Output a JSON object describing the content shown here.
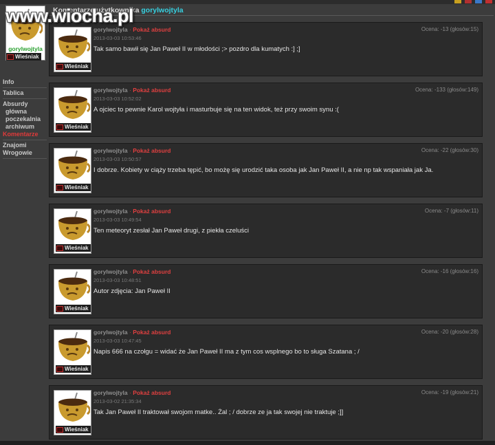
{
  "watermark": "www.wiocha.pl",
  "page": {
    "title_prefix": "Komentarze użytkownika",
    "title_user": "gorylwojtyla"
  },
  "profile": {
    "username": "gorylwojtyla",
    "rank": "Wieśniak"
  },
  "nav": [
    {
      "label": "Info",
      "level": 0,
      "active": false
    },
    {
      "label": "Tablica",
      "level": 0,
      "active": false
    },
    {
      "label": "Absurdy",
      "level": 0,
      "active": false
    },
    {
      "label": "główna",
      "level": 1,
      "active": false
    },
    {
      "label": "poczekalnia",
      "level": 1,
      "active": false
    },
    {
      "label": "archiwum",
      "level": 1,
      "active": false
    },
    {
      "label": "Komentarze",
      "level": 0,
      "active": true
    },
    {
      "label": "Znajomi",
      "level": 0,
      "active": false
    },
    {
      "label": "Wrogowie",
      "level": 0,
      "active": false
    }
  ],
  "comments": [
    {
      "author": "gorylwojtyla",
      "sep": "·",
      "link": "Pokaż absurd",
      "date": "2013-03-03 10:53:46",
      "rating": "Ocena: -13 (głosów:15)",
      "text": "Tak samo bawił się Jan Paweł II w młodości ;> pozdro dla kumatych :] ;]",
      "rank": "Wieśniak"
    },
    {
      "author": "gorylwojtyla",
      "sep": "·",
      "link": "Pokaż absurd",
      "date": "2013-03-03 10:52:02",
      "rating": "Ocena: -133 (głosów:149)",
      "text": "A ojciec to pewnie Karol wojtyła i masturbuje się na ten widok, też przy swoim synu :(",
      "rank": "Wieśniak"
    },
    {
      "author": "gorylwojtyla",
      "sep": "·",
      "link": "Pokaż absurd",
      "date": "2013-03-03 10:50:57",
      "rating": "Ocena: -22 (głosów:30)",
      "text": "I dobrze. Kobiety w ciąży trzeba tępić, bo możę się urodzić taka osoba jak Jan Paweł II, a nie np tak wspaniała jak Ja.",
      "rank": "Wieśniak"
    },
    {
      "author": "gorylwojtyla",
      "sep": "·",
      "link": "Pokaż absurd",
      "date": "2013-03-03 10:49:54",
      "rating": "Ocena: -7 (głosów:11)",
      "text": "Ten meteoryt zesłał Jan Paweł drugi, z piekła czeluści",
      "rank": "Wieśniak"
    },
    {
      "author": "gorylwojtyla",
      "sep": "·",
      "link": "Pokaż absurd",
      "date": "2013-03-03 10:48:51",
      "rating": "Ocena: -16 (głosów:16)",
      "text": "Autor zdjęcia: Jan Paweł II",
      "rank": "Wieśniak"
    },
    {
      "author": "gorylwojtyla",
      "sep": "·",
      "link": "Pokaż absurd",
      "date": "2013-03-03 10:47:45",
      "rating": "Ocena: -20 (głosów:28)",
      "text": "Napis 666 na czołgu = widać że Jan Paweł II ma z tym cos wsplnego bo to sługa Szatana ; /",
      "rank": "Wieśniak"
    },
    {
      "author": "gorylwojtyla",
      "sep": "·",
      "link": "Pokaż absurd",
      "date": "2013-03-02 21:35:34",
      "rating": "Ocena: -19 (głosów:21)",
      "text": "Tak Jan Paweł II traktował swojom matke.. Żal ; / dobrze ze ja tak swojej nie traktuje ;]]",
      "rank": "Wieśniak"
    }
  ],
  "colors": {
    "background": "#3c3c3c",
    "panel": "#2b2b2b",
    "accent_link": "#e04040",
    "username_cyan": "#36d0e0",
    "username_green": "#2aa030"
  }
}
